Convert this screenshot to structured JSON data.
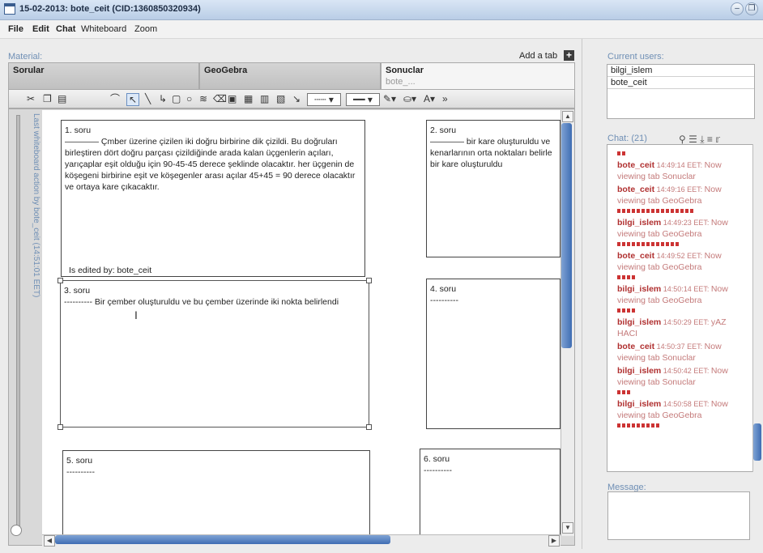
{
  "window": {
    "title": "15-02-2013: bote_ceit (CID:1360850320934)"
  },
  "menu": [
    "File",
    "Edit",
    "Chat",
    "Whiteboard",
    "Zoom"
  ],
  "material": {
    "label": "Material:",
    "add_tab": "Add a tab",
    "tabs": [
      {
        "label": "Sorular",
        "sub": ""
      },
      {
        "label": "GeoGebra",
        "sub": ""
      },
      {
        "label": "Sonuclar",
        "sub": "bote_..."
      }
    ],
    "vertical_label": "Last whiteboard action by bote_ceit (14:51:01 EET)",
    "edited_by": "Is edited by: bote_ceit",
    "boxes": [
      {
        "title": "1. soru",
        "text": "———— Çmber üzerine çizilen iki doğru birbirine dik çizildi. Bu doğruları birleştiren dört doğru parçası çizildiğinde arada kalan üçgenlerin açıları, yarıçaplar eşit olduğu için 90-45-45 derece şeklinde olacaktır. her üçgenin de köşegeni birbirine eşit ve köşegenler arası açılar 45+45 = 90 derece olacaktır ve ortaya kare çıkacaktır."
      },
      {
        "title": "2. soru",
        "text": "———— bir kare oluşturuldu ve kenarlarının orta noktaları belirle bir kare oluşturuldu"
      },
      {
        "title": "3. soru",
        "text": "---------- Bir çember oluşturuldu ve bu çember üzerinde iki nokta belirlendi"
      },
      {
        "title": "4. soru",
        "text": "----------"
      },
      {
        "title": "5. soru",
        "text": "----------"
      },
      {
        "title": "6. soru",
        "text": "----------"
      }
    ]
  },
  "users": {
    "label": "Current users:",
    "list": [
      "bilgi_islem",
      "bote_ceit"
    ]
  },
  "chat": {
    "label": "Chat: (21)",
    "messages": [
      {
        "name": "bote_ceit",
        "time": "14:49:14 EET:",
        "text": "Now viewing tab Sonuclar",
        "bars": 0
      },
      {
        "name": "bote_ceit",
        "time": "14:49:16 EET:",
        "text": "Now viewing tab GeoGebra",
        "bars": 16
      },
      {
        "name": "bilgi_islem",
        "time": "14:49:23 EET:",
        "text": "Now viewing tab GeoGebra",
        "bars": 13
      },
      {
        "name": "bote_ceit",
        "time": "14:49:52 EET:",
        "text": "Now viewing tab GeoGebra",
        "bars": 4
      },
      {
        "name": "bilgi_islem",
        "time": "14:50:14 EET:",
        "text": "Now viewing tab GeoGebra",
        "bars": 4
      },
      {
        "name": "bilgi_islem",
        "time": "14:50:29 EET:",
        "text": "yAZ HACI",
        "bars": 0
      },
      {
        "name": "bote_ceit",
        "time": "14:50:37 EET:",
        "text": "Now viewing tab Sonuclar",
        "bars": 0
      },
      {
        "name": "bilgi_islem",
        "time": "14:50:42 EET:",
        "text": "Now viewing tab Sonuclar",
        "bars": 3
      },
      {
        "name": "bilgi_islem",
        "time": "14:50:58 EET:",
        "text": "Now viewing tab GeoGebra",
        "bars": 9
      }
    ]
  },
  "message": {
    "label": "Message:"
  },
  "colors": {
    "accent": "#6f8fb5",
    "user_name": "#b03030",
    "chat_text": "#c47a7a",
    "scroll": "#3f6db3"
  }
}
